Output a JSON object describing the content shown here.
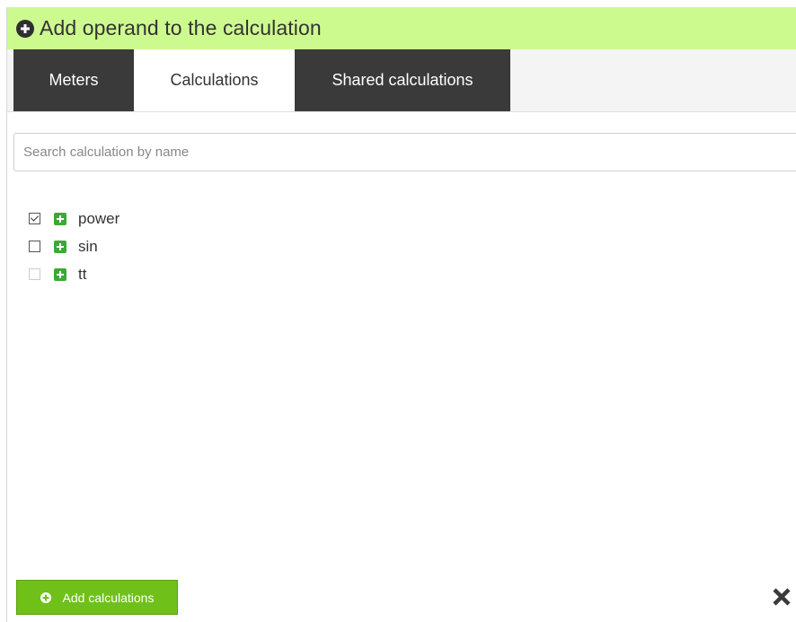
{
  "dialog": {
    "title": "Add operand to the calculation",
    "header_icon": "plus-circle-icon",
    "header_color": "#cdfa8f"
  },
  "tabs": [
    {
      "label": "Meters",
      "active": false
    },
    {
      "label": "Calculations",
      "active": true
    },
    {
      "label": "Shared calculations",
      "active": false
    }
  ],
  "search": {
    "placeholder": "Search calculation by name",
    "value": ""
  },
  "calculations": [
    {
      "name": "power",
      "checked": true,
      "enabled": true
    },
    {
      "name": "sin",
      "checked": false,
      "enabled": true
    },
    {
      "name": "tt",
      "checked": false,
      "enabled": false
    }
  ],
  "footer": {
    "add_label": "Add calculations",
    "add_icon": "plus-circle-icon",
    "close_icon": "close-icon",
    "accent_color": "#6fc11a"
  }
}
